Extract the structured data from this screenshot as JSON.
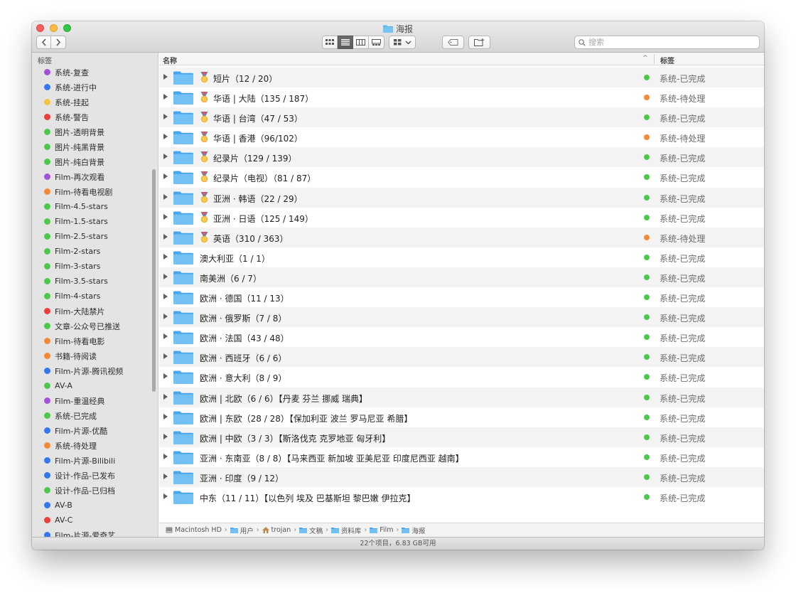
{
  "window": {
    "title": "海报",
    "search_placeholder": "搜索",
    "status": "22个项目，6.83 GB可用"
  },
  "sidebar": {
    "header": "标签",
    "tags": [
      {
        "label": "系统-复查",
        "color": "#a550d8"
      },
      {
        "label": "系统-进行中",
        "color": "#3478f0"
      },
      {
        "label": "系统-挂起",
        "color": "#f8c23a"
      },
      {
        "label": "系统-警告",
        "color": "#ef3d3b"
      },
      {
        "label": "图片-透明背景",
        "color": "#4cc84a"
      },
      {
        "label": "图片-纯黑背景",
        "color": "#4cc84a"
      },
      {
        "label": "图片-纯白背景",
        "color": "#4cc84a"
      },
      {
        "label": "Film-再次观看",
        "color": "#a550d8"
      },
      {
        "label": "Film-待看电视剧",
        "color": "#f68a34"
      },
      {
        "label": "Film-4.5-stars",
        "color": "#4cc84a"
      },
      {
        "label": "Film-1.5-stars",
        "color": "#4cc84a"
      },
      {
        "label": "Film-2.5-stars",
        "color": "#4cc84a"
      },
      {
        "label": "Film-2-stars",
        "color": "#4cc84a"
      },
      {
        "label": "Film-3-stars",
        "color": "#4cc84a"
      },
      {
        "label": "Film-3.5-stars",
        "color": "#4cc84a"
      },
      {
        "label": "Film-4-stars",
        "color": "#4cc84a"
      },
      {
        "label": "Film-大陆禁片",
        "color": "#ef3d3b"
      },
      {
        "label": "文章-公众号已推送",
        "color": "#4cc84a"
      },
      {
        "label": "Film-待看电影",
        "color": "#f68a34"
      },
      {
        "label": "书籍-待阅读",
        "color": "#f68a34"
      },
      {
        "label": "Film-片源-腾讯视频",
        "color": "#3478f0"
      },
      {
        "label": "AV-A",
        "color": "#4cc84a"
      },
      {
        "label": "Film-重温经典",
        "color": "#a550d8"
      },
      {
        "label": "系统-已完成",
        "color": "#4cc84a"
      },
      {
        "label": "Film-片源-优酷",
        "color": "#3478f0"
      },
      {
        "label": "系统-待处理",
        "color": "#f68a34"
      },
      {
        "label": "Film-片源-Bilibili",
        "color": "#3478f0"
      },
      {
        "label": "设计-作品-已发布",
        "color": "#3478f0"
      },
      {
        "label": "设计-作品-已归档",
        "color": "#4cc84a"
      },
      {
        "label": "AV-B",
        "color": "#3478f0"
      },
      {
        "label": "AV-C",
        "color": "#ef3d3b"
      },
      {
        "label": "Film-片源-爱奇艺",
        "color": "#3478f0"
      }
    ]
  },
  "columns": {
    "name": "名称",
    "tags": "标签"
  },
  "rows": [
    {
      "name": "短片（12 / 20）",
      "medal": true,
      "tag": "系统-已完成",
      "tag_color": "#4cc84a"
    },
    {
      "name": "华语 | 大陆（135 / 187）",
      "medal": true,
      "tag": "系统-待处理",
      "tag_color": "#f68a34"
    },
    {
      "name": "华语 | 台湾（47 / 53）",
      "medal": true,
      "tag": "系统-已完成",
      "tag_color": "#4cc84a"
    },
    {
      "name": "华语 | 香港（96/102）",
      "medal": true,
      "tag": "系统-待处理",
      "tag_color": "#f68a34"
    },
    {
      "name": "纪录片（129 / 139）",
      "medal": true,
      "tag": "系统-已完成",
      "tag_color": "#4cc84a"
    },
    {
      "name": "纪录片（电视）（81 / 87）",
      "medal": true,
      "tag": "系统-已完成",
      "tag_color": "#4cc84a"
    },
    {
      "name": "亚洲 · 韩语（22 / 29）",
      "medal": true,
      "tag": "系统-已完成",
      "tag_color": "#4cc84a"
    },
    {
      "name": "亚洲 · 日语（125 / 149）",
      "medal": true,
      "tag": "系统-已完成",
      "tag_color": "#4cc84a"
    },
    {
      "name": "英语（310 / 363）",
      "medal": true,
      "tag": "系统-待处理",
      "tag_color": "#f68a34"
    },
    {
      "name": "澳大利亚（1 / 1）",
      "medal": false,
      "tag": "系统-已完成",
      "tag_color": "#4cc84a"
    },
    {
      "name": "南美洲（6 / 7）",
      "medal": false,
      "tag": "系统-已完成",
      "tag_color": "#4cc84a"
    },
    {
      "name": "欧洲 · 德国（11 / 13）",
      "medal": false,
      "tag": "系统-已完成",
      "tag_color": "#4cc84a"
    },
    {
      "name": "欧洲 · 俄罗斯（7 / 8）",
      "medal": false,
      "tag": "系统-已完成",
      "tag_color": "#4cc84a"
    },
    {
      "name": "欧洲 · 法国（43 / 48）",
      "medal": false,
      "tag": "系统-已完成",
      "tag_color": "#4cc84a"
    },
    {
      "name": "欧洲 · 西班牙（6 / 6）",
      "medal": false,
      "tag": "系统-已完成",
      "tag_color": "#4cc84a"
    },
    {
      "name": "欧洲 · 意大利（8 / 9）",
      "medal": false,
      "tag": "系统-已完成",
      "tag_color": "#4cc84a"
    },
    {
      "name": "欧洲 | 北欧（6 / 6）【丹麦 芬兰 挪威 瑞典】",
      "medal": false,
      "tag": "系统-已完成",
      "tag_color": "#4cc84a"
    },
    {
      "name": "欧洲 | 东欧（28 / 28）【保加利亚 波兰 罗马尼亚 希腊】",
      "medal": false,
      "tag": "系统-已完成",
      "tag_color": "#4cc84a"
    },
    {
      "name": "欧洲 | 中欧（3 / 3）【斯洛伐克 克罗地亚 匈牙利】",
      "medal": false,
      "tag": "系统-已完成",
      "tag_color": "#4cc84a"
    },
    {
      "name": "亚洲 · 东南亚（8 / 8）【马来西亚 新加坡 亚美尼亚 印度尼西亚 越南】",
      "medal": false,
      "tag": "系统-已完成",
      "tag_color": "#4cc84a"
    },
    {
      "name": "亚洲 · 印度（9 / 12）",
      "medal": false,
      "tag": "系统-已完成",
      "tag_color": "#4cc84a"
    },
    {
      "name": "中东（11 / 11）【以色列 埃及 巴基斯坦 黎巴嫩 伊拉克】",
      "medal": false,
      "tag": "系统-已完成",
      "tag_color": "#4cc84a"
    }
  ],
  "path": [
    {
      "label": "Macintosh HD",
      "icon": "hard-drive-icon"
    },
    {
      "label": "用户",
      "icon": "folder-icon"
    },
    {
      "label": "trojan",
      "icon": "home-icon"
    },
    {
      "label": "文稿",
      "icon": "folder-icon"
    },
    {
      "label": "资料库",
      "icon": "folder-icon"
    },
    {
      "label": "Film",
      "icon": "folder-icon"
    },
    {
      "label": "海报",
      "icon": "folder-icon"
    }
  ],
  "colors": {
    "folder_blue": "#5eb4f0",
    "green": "#4cc84a",
    "orange": "#f68a34"
  }
}
